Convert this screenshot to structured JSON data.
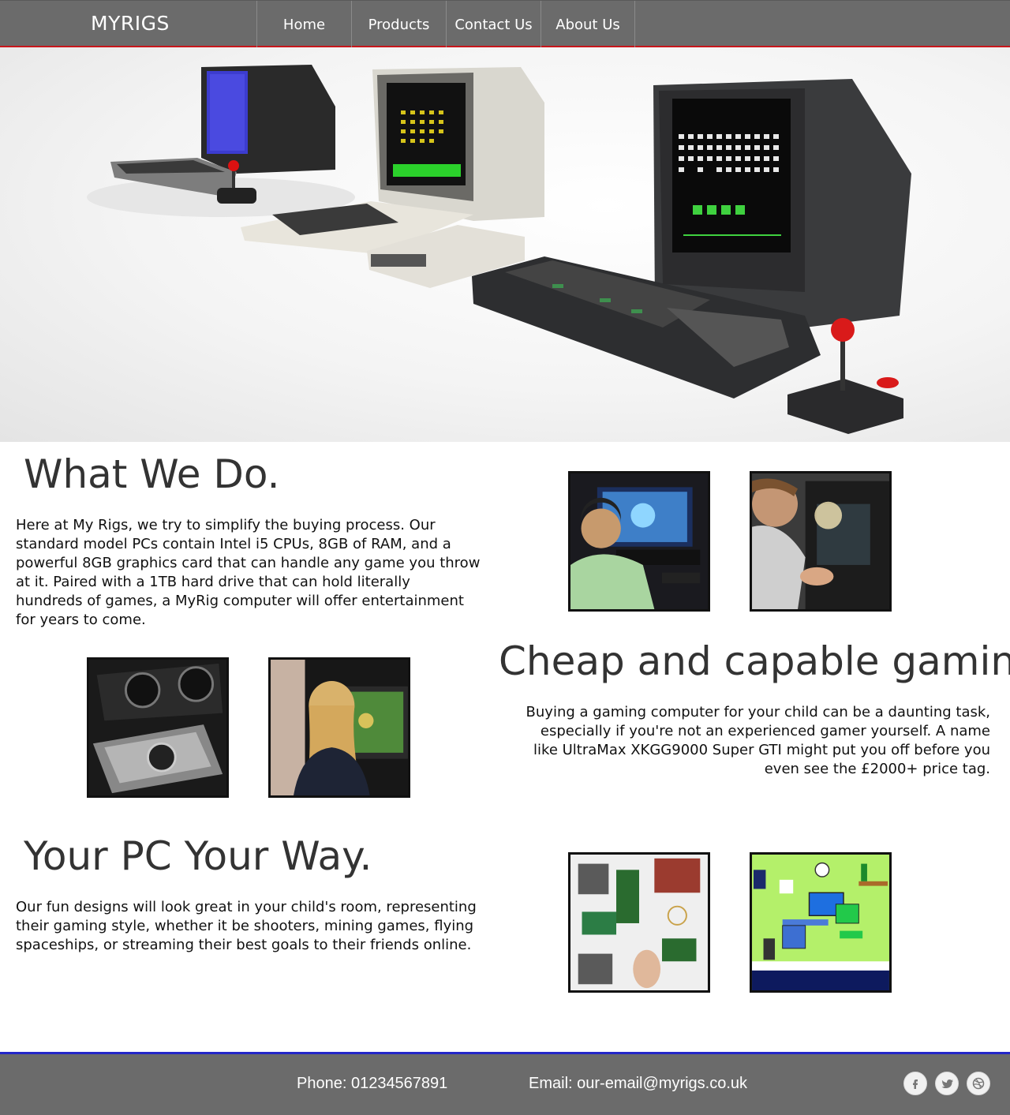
{
  "nav": {
    "brand": "MYRIGS",
    "items": [
      {
        "label": "Home"
      },
      {
        "label": "Products"
      },
      {
        "label": "Contact Us"
      },
      {
        "label": "About Us"
      }
    ]
  },
  "sections": {
    "what_we_do": {
      "title": "What We Do.",
      "body": "Here at My Rigs, we try to simplify the buying process. Our standard model PCs contain Intel i5 CPUs, 8GB of RAM, and a powerful 8GB graphics card that can handle any game you throw at it. Paired with a 1TB hard drive that can hold literally hundreds of games, a MyRig computer will offer entertainment for years to come."
    },
    "cheap_gaming": {
      "title": "Cheap and capable gaming.",
      "body": "Buying a gaming computer for your child can be a daunting task, especially if you're not an experienced gamer yourself. A name like UltraMax XKGG9000 Super GTI might put you off before you even see the £2000+ price tag."
    },
    "your_pc": {
      "title": "Your PC Your Way.",
      "body": "Our fun designs will look great in your child's room, representing their gaming style, whether it be shooters, mining games, flying spaceships, or streaming their best goals to their friends online."
    }
  },
  "footer": {
    "phone": "Phone: 01234567891",
    "email": "Email: our-email@myrigs.co.uk",
    "social": [
      "facebook-icon",
      "twitter-icon",
      "dribbble-icon"
    ]
  },
  "colors": {
    "nav_bg": "#6b6b6b",
    "nav_accent": "#c8161b",
    "footer_accent": "#2326c8",
    "heading": "#333333"
  }
}
